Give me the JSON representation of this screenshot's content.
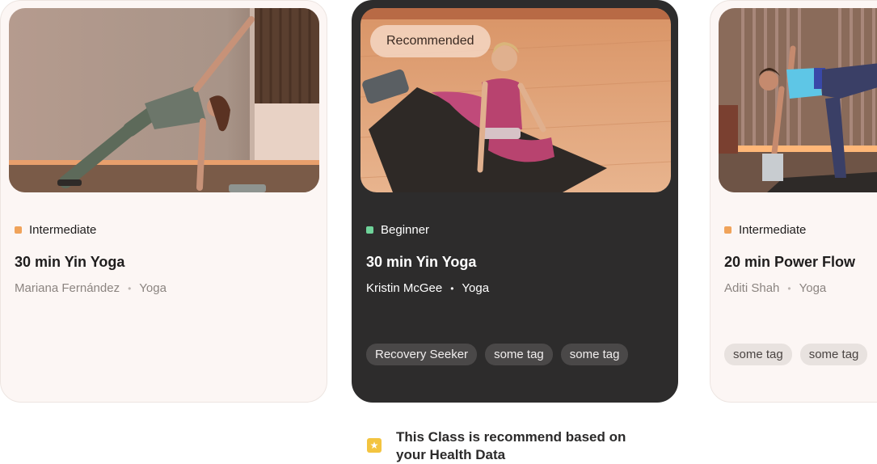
{
  "cards": [
    {
      "level": "Intermediate",
      "level_color": "#f0a35a",
      "title": "30 min Yin Yoga",
      "instructor": "Mariana Fernández",
      "category": "Yoga",
      "separator": "•",
      "tags": [],
      "theme": "light",
      "image": "yoga-side-plank-photo"
    },
    {
      "badge": "Recommended",
      "level": "Beginner",
      "level_color": "#6fd39a",
      "title": "30 min Yin Yoga",
      "instructor": "Kristin McGee",
      "category": "Yoga",
      "separator": "•",
      "tags": [
        "Recovery Seeker",
        "some tag",
        "some tag"
      ],
      "theme": "dark",
      "image": "yoga-mat-stretch-photo"
    },
    {
      "level": "Intermediate",
      "level_color": "#f0a35a",
      "title": "20 min Power Flow",
      "instructor": "Aditi Shah",
      "category": "Yoga",
      "separator": "•",
      "tags": [
        "some tag",
        "some tag"
      ],
      "theme": "light",
      "image": "half-moon-pose-photo"
    }
  ],
  "recommendation_note": {
    "icon": "star-icon",
    "text": "This Class is recommend based on\nyour  Health Data"
  }
}
